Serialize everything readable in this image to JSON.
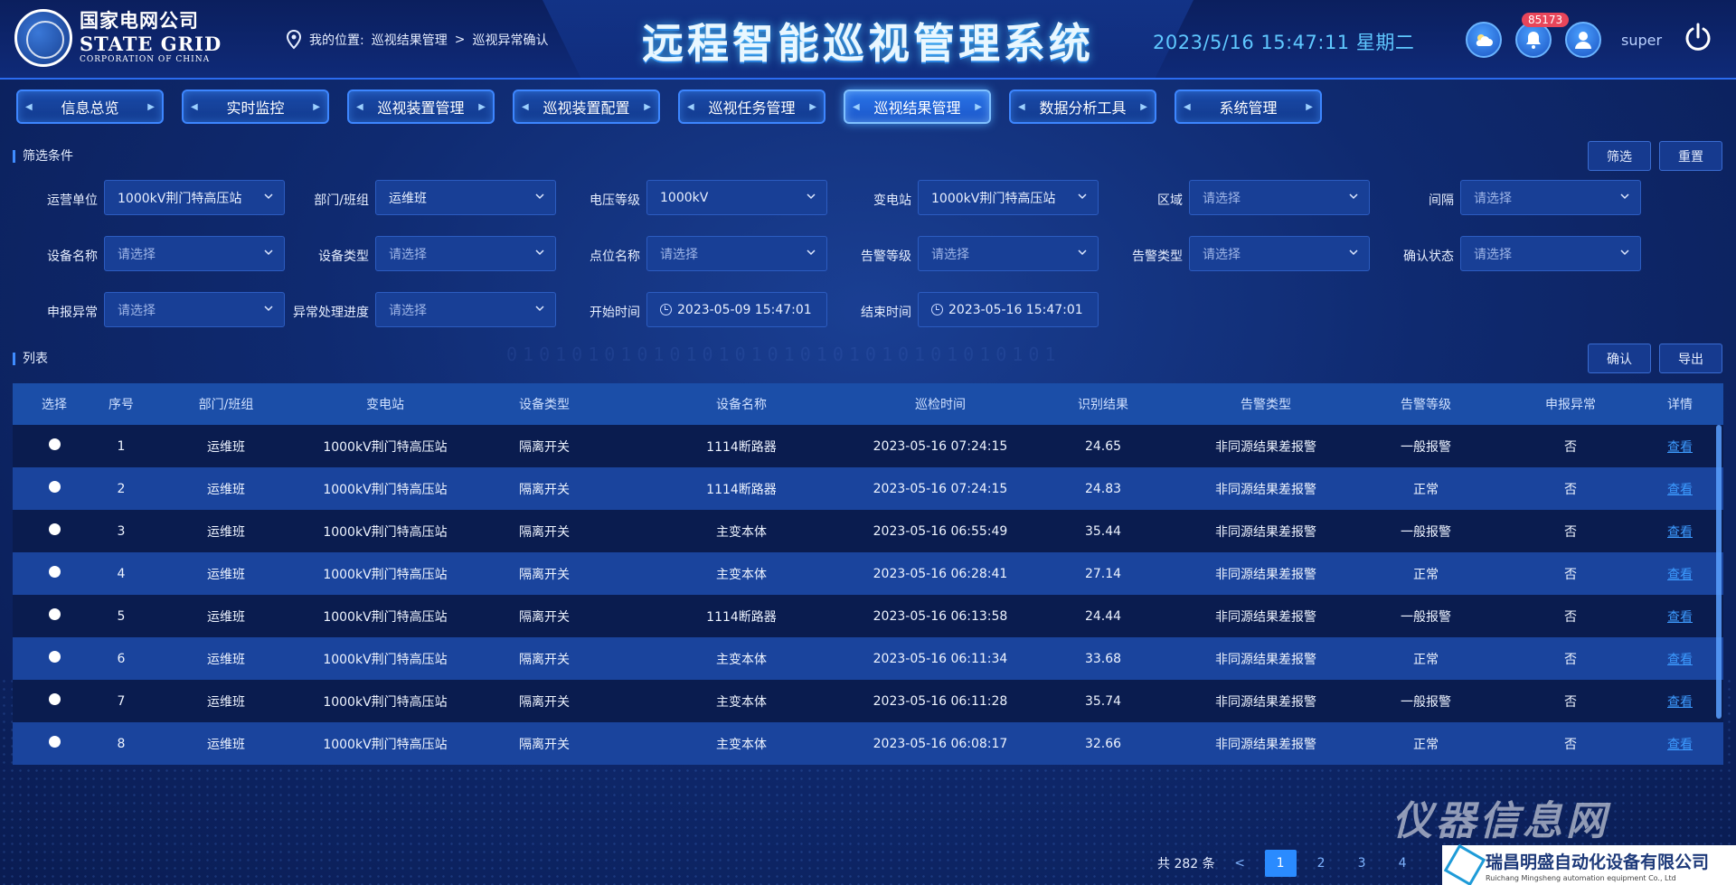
{
  "brand": {
    "logo_cn": "国家电网公司",
    "logo_en": "STATE GRID",
    "logo_en_sub": "CORPORATION OF CHINA"
  },
  "breadcrumb": {
    "prefix": "我的位置:",
    "level1": "巡视结果管理",
    "separator": ">",
    "level2": "巡视异常确认"
  },
  "header": {
    "title": "远程智能巡视管理系统",
    "datetime": "2023/5/16 15:47:11 星期二",
    "notification_count": "85173",
    "username": "super",
    "icons": [
      "weather-icon",
      "bell-icon",
      "user-icon",
      "power-icon"
    ]
  },
  "nav": [
    {
      "label": "信息总览",
      "active": false
    },
    {
      "label": "实时监控",
      "active": false
    },
    {
      "label": "巡视装置管理",
      "active": false
    },
    {
      "label": "巡视装置配置",
      "active": false
    },
    {
      "label": "巡视任务管理",
      "active": false
    },
    {
      "label": "巡视结果管理",
      "active": true
    },
    {
      "label": "数据分析工具",
      "active": false
    },
    {
      "label": "系统管理",
      "active": false
    }
  ],
  "filter_section": {
    "title": "筛选条件",
    "btn_filter": "筛选",
    "btn_reset": "重置",
    "fields": {
      "ops_unit": {
        "label": "运营单位",
        "value": "1000kV荆门特高压站"
      },
      "dept": {
        "label": "部门/班组",
        "value": "运维班"
      },
      "voltage": {
        "label": "电压等级",
        "value": "1000kV"
      },
      "substation": {
        "label": "变电站",
        "value": "1000kV荆门特高压站"
      },
      "area": {
        "label": "区域",
        "value": "请选择"
      },
      "bay": {
        "label": "间隔",
        "value": "请选择"
      },
      "device_name": {
        "label": "设备名称",
        "value": "请选择"
      },
      "device_type": {
        "label": "设备类型",
        "value": "请选择"
      },
      "point_name": {
        "label": "点位名称",
        "value": "请选择"
      },
      "alarm_level": {
        "label": "告警等级",
        "value": "请选择"
      },
      "alarm_type": {
        "label": "告警类型",
        "value": "请选择"
      },
      "confirm_status": {
        "label": "确认状态",
        "value": "请选择"
      },
      "report_abnormal": {
        "label": "申报异常",
        "value": "请选择"
      },
      "process_progress": {
        "label": "异常处理进度",
        "value": "请选择"
      },
      "start_time": {
        "label": "开始时间",
        "value": "2023-05-09 15:47:01"
      },
      "end_time": {
        "label": "结束时间",
        "value": "2023-05-16 15:47:01"
      }
    }
  },
  "list_section": {
    "title": "列表",
    "btn_confirm": "确认",
    "btn_export": "导出"
  },
  "table": {
    "headers": [
      "选择",
      "序号",
      "部门/班组",
      "变电站",
      "设备类型",
      "设备名称",
      "巡检时间",
      "识别结果",
      "告警类型",
      "告警等级",
      "申报异常",
      "详情"
    ],
    "rows": [
      {
        "no": "1",
        "dept": "运维班",
        "station": "1000kV荆门特高压站",
        "type": "隔离开关",
        "name": "1114断路器",
        "time": "2023-05-16 07:24:15",
        "result": "24.65",
        "alarm_type": "非同源结果差报警",
        "alarm_level": "一般报警",
        "report": "否",
        "detail": "查看"
      },
      {
        "no": "2",
        "dept": "运维班",
        "station": "1000kV荆门特高压站",
        "type": "隔离开关",
        "name": "1114断路器",
        "time": "2023-05-16 07:24:15",
        "result": "24.83",
        "alarm_type": "非同源结果差报警",
        "alarm_level": "正常",
        "report": "否",
        "detail": "查看"
      },
      {
        "no": "3",
        "dept": "运维班",
        "station": "1000kV荆门特高压站",
        "type": "隔离开关",
        "name": "主变本体",
        "time": "2023-05-16 06:55:49",
        "result": "35.44",
        "alarm_type": "非同源结果差报警",
        "alarm_level": "一般报警",
        "report": "否",
        "detail": "查看"
      },
      {
        "no": "4",
        "dept": "运维班",
        "station": "1000kV荆门特高压站",
        "type": "隔离开关",
        "name": "主变本体",
        "time": "2023-05-16 06:28:41",
        "result": "27.14",
        "alarm_type": "非同源结果差报警",
        "alarm_level": "正常",
        "report": "否",
        "detail": "查看"
      },
      {
        "no": "5",
        "dept": "运维班",
        "station": "1000kV荆门特高压站",
        "type": "隔离开关",
        "name": "1114断路器",
        "time": "2023-05-16 06:13:58",
        "result": "24.44",
        "alarm_type": "非同源结果差报警",
        "alarm_level": "一般报警",
        "report": "否",
        "detail": "查看"
      },
      {
        "no": "6",
        "dept": "运维班",
        "station": "1000kV荆门特高压站",
        "type": "隔离开关",
        "name": "主变本体",
        "time": "2023-05-16 06:11:34",
        "result": "33.68",
        "alarm_type": "非同源结果差报警",
        "alarm_level": "正常",
        "report": "否",
        "detail": "查看"
      },
      {
        "no": "7",
        "dept": "运维班",
        "station": "1000kV荆门特高压站",
        "type": "隔离开关",
        "name": "主变本体",
        "time": "2023-05-16 06:11:28",
        "result": "35.74",
        "alarm_type": "非同源结果差报警",
        "alarm_level": "一般报警",
        "report": "否",
        "detail": "查看"
      },
      {
        "no": "8",
        "dept": "运维班",
        "station": "1000kV荆门特高压站",
        "type": "隔离开关",
        "name": "主变本体",
        "time": "2023-05-16 06:08:17",
        "result": "32.66",
        "alarm_type": "非同源结果差报警",
        "alarm_level": "正常",
        "report": "否",
        "detail": "查看"
      }
    ]
  },
  "pagination": {
    "total_text": "共 282 条",
    "prev": "<",
    "pages": [
      "1",
      "2",
      "3",
      "4"
    ],
    "current": "1"
  },
  "watermark": {
    "site": "仪器信息网",
    "company_cn": "瑞昌明盛自动化设备有限公司",
    "company_en": "Ruichang Mingsheng automation equipment Co., Ltd"
  },
  "colors": {
    "accent": "#2a8bff",
    "title_glow": "#50c8ff",
    "link": "#3d9bff",
    "badge": "#e8455a"
  }
}
